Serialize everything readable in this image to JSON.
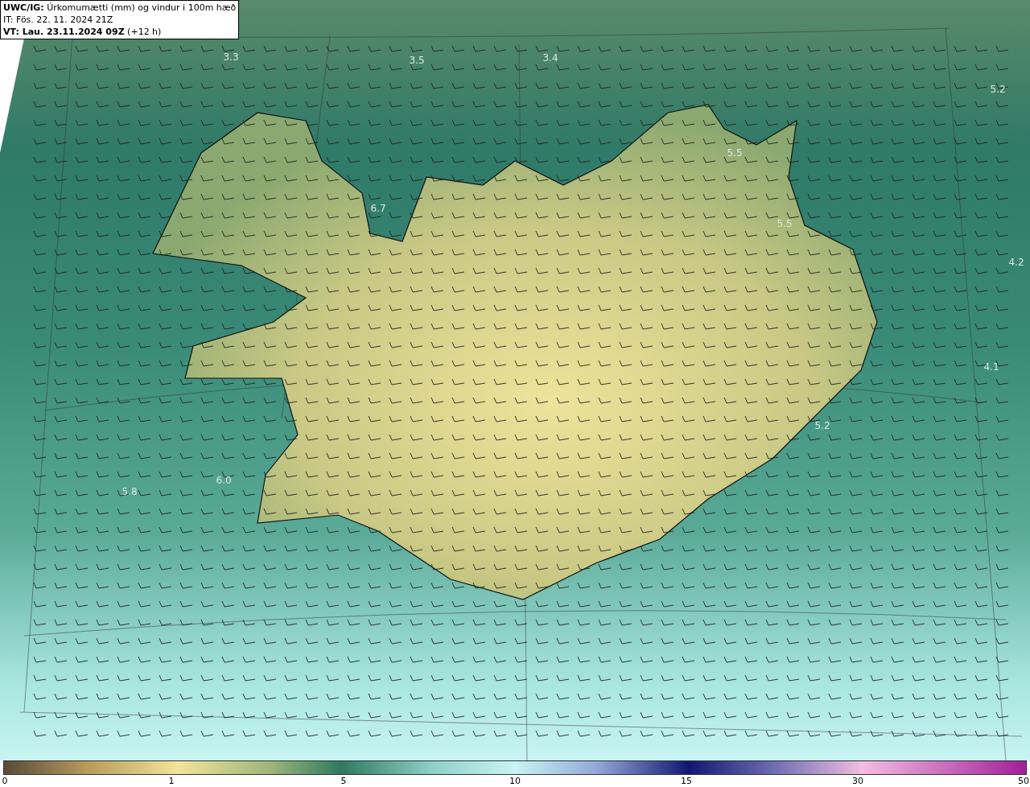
{
  "header": {
    "lines": [
      "**UWC/IG:** Úrkomumætti (mm) og vindur i 100m hæð",
      "IT: Fös. 22. 11. 2024 21Z",
      "**VT: Lau. 23.11.2024 09Z** (+12 h)"
    ]
  },
  "map": {
    "value_labels": [
      "3.3",
      "3.5",
      "3.4",
      "5.2",
      "5.5",
      "6.7",
      "5.5",
      "4.2",
      "4.1",
      "5.2",
      "6.0",
      "5.8"
    ]
  },
  "color_scale": {
    "ticks": [
      "0",
      "1",
      "5",
      "10",
      "15",
      "30",
      "50"
    ]
  }
}
